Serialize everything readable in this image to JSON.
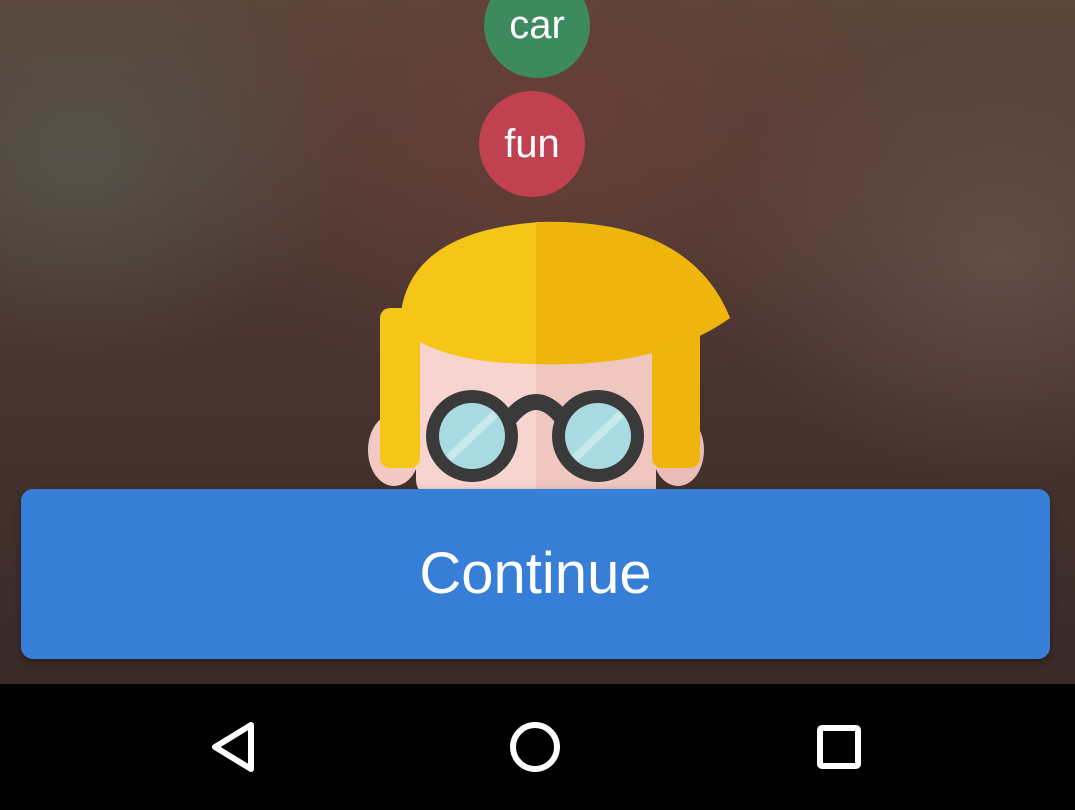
{
  "tags": [
    {
      "label": "car",
      "color": "#3e8a5f"
    },
    {
      "label": "fun",
      "color": "#c0414f"
    }
  ],
  "avatar": {
    "icon": "nerd-avatar-icon"
  },
  "continue_button": {
    "label": "Continue",
    "color": "#377ed7"
  },
  "navigation_bar": {
    "back_icon": "back-triangle-icon",
    "home_icon": "home-circle-icon",
    "recent_icon": "recent-apps-square-icon"
  }
}
